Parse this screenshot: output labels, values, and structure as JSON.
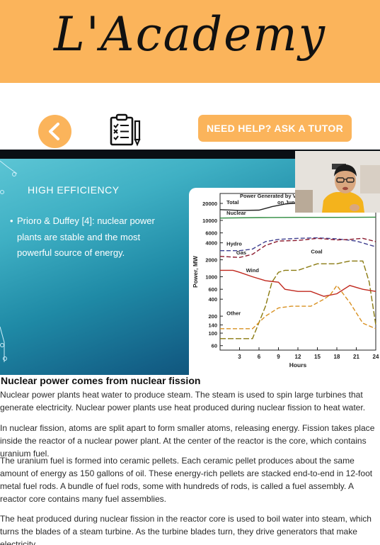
{
  "header": {
    "title": "L'Academy"
  },
  "toolbar": {
    "back_icon": "chevron-left-icon",
    "checklist_icon": "checklist-icon",
    "help_label": "NEED HELP? ASK A TUTOR"
  },
  "slide": {
    "heading": "HIGH EFFICIENCY",
    "bullet": "Prioro & Duffey [4]: nuclear power plants are stable and the most powerful source of energy."
  },
  "chart_data": {
    "type": "line",
    "title_visible": "Power Generated by V... on Jun...",
    "title_line1": "Power Generated by V",
    "title_line2": "on Jun",
    "xlabel": "Hours",
    "ylabel": "Power, MW",
    "yscale": "log",
    "xlim": [
      0,
      24
    ],
    "ylim": [
      50,
      30000
    ],
    "x_ticks": [
      3,
      6,
      9,
      12,
      15,
      18,
      21,
      24
    ],
    "y_ticks": [
      60,
      100,
      140,
      200,
      400,
      600,
      1000,
      2000,
      4000,
      6000,
      10000,
      20000
    ],
    "x_tick_labels": [
      "3",
      "6",
      "9",
      "12",
      "15",
      "18",
      "21",
      "24"
    ],
    "y_tick_labels": [
      "60",
      "100",
      "140",
      "200",
      "400",
      "600",
      "1000",
      "2000",
      "4000",
      "6000",
      "10000",
      "20000"
    ],
    "series": [
      {
        "name": "Total",
        "color": "#222222",
        "dash": "",
        "x": [
          0,
          3,
          6,
          8,
          10,
          12,
          15,
          18,
          21,
          24
        ],
        "y": [
          15500,
          15000,
          15200,
          17500,
          19500,
          20500,
          21000,
          21500,
          20500,
          18000
        ]
      },
      {
        "name": "Nuclear",
        "color": "#2e8b3e",
        "dash": "",
        "x": [
          0,
          6,
          12,
          18,
          24
        ],
        "y": [
          11000,
          11200,
          11300,
          11300,
          11400
        ]
      },
      {
        "name": "Hydro",
        "color": "#3f3f8f",
        "dash": "6,3",
        "x": [
          0,
          3,
          5,
          7,
          9,
          12,
          15,
          18,
          21,
          24
        ],
        "y": [
          2900,
          2900,
          3100,
          4200,
          4600,
          4800,
          4900,
          4700,
          4300,
          3400
        ]
      },
      {
        "name": "Gas",
        "color": "#8b1a2e",
        "dash": "6,3",
        "x": [
          0,
          3,
          5,
          7,
          9,
          12,
          15,
          18,
          20,
          22,
          24
        ],
        "y": [
          2300,
          2200,
          2500,
          3600,
          4300,
          4400,
          4800,
          4500,
          4600,
          4800,
          4200
        ]
      },
      {
        "name": "Coal",
        "color": "#8a7a10",
        "dash": "8,3",
        "x": [
          0,
          5,
          7,
          8,
          9,
          10,
          12,
          15,
          18,
          20,
          22,
          23,
          24
        ],
        "y": [
          80,
          80,
          300,
          800,
          1200,
          1300,
          1300,
          1700,
          1700,
          1900,
          1900,
          800,
          140
        ]
      },
      {
        "name": "Wind",
        "color": "#c0281e",
        "dash": "",
        "x": [
          0,
          2,
          3,
          5,
          7,
          9,
          10,
          12,
          14,
          16,
          18,
          20,
          22,
          24
        ],
        "y": [
          1300,
          1300,
          1200,
          1000,
          850,
          800,
          600,
          550,
          550,
          450,
          500,
          700,
          600,
          550
        ]
      },
      {
        "name": "Other",
        "color": "#d89020",
        "dash": "6,3",
        "x": [
          0,
          5,
          7,
          9,
          11,
          14,
          16,
          17,
          18,
          20,
          22,
          24
        ],
        "y": [
          120,
          120,
          200,
          280,
          300,
          300,
          400,
          480,
          700,
          350,
          150,
          120
        ]
      }
    ]
  },
  "article": {
    "title": "Nuclear power comes from nuclear fission",
    "paragraphs": [
      "Nuclear power plants heat water to produce steam. The steam is used to spin large turbines that generate electricity. Nuclear power plants use heat produced during nuclear fission to heat water.",
      "In nuclear fission, atoms are split apart to form smaller atoms, releasing energy. Fission takes place inside the reactor of a nuclear power plant. At the center of the reactor is the core, which contains uranium fuel.",
      "The uranium fuel is formed into ceramic pellets. Each ceramic pellet produces about the same amount of energy as 150 gallons of oil. These energy-rich pellets are stacked end-to-end in 12-foot metal fuel rods. A bundle of fuel rods, some with hundreds of rods, is called a fuel assembly. A reactor core contains many fuel assemblies.",
      "The heat produced during nuclear fission in the reactor core is used to boil water into steam, which turns the blades of a steam turbine. As the turbine blades turn, they drive generators that make electricity."
    ]
  }
}
